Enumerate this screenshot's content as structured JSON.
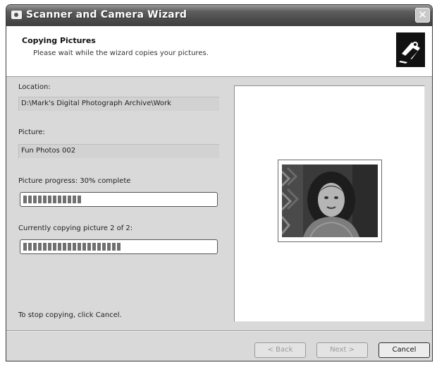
{
  "window": {
    "title": "Scanner and Camera Wizard",
    "close_glyph": "✕"
  },
  "header": {
    "title": "Copying Pictures",
    "subtitle": "Please wait while the wizard copies your pictures.",
    "icon": "camera-scanner-icon"
  },
  "form": {
    "location_label": "Location:",
    "location_value": "D:\\Mark's Digital Photograph Archive\\Work",
    "picture_label": "Picture:",
    "picture_value": "Fun Photos 002",
    "picture_progress_label": "Picture progress: 30% complete",
    "picture_progress": 0.3,
    "copying_label": "Currently copying picture 2 of 2:",
    "copying_progress": 0.5
  },
  "preview": {
    "icon": "photo-thumbnail"
  },
  "footer": {
    "stop_text": "To stop copying, click Cancel.",
    "back_label": "< Back",
    "next_label": "Next >",
    "cancel_label": "Cancel"
  }
}
